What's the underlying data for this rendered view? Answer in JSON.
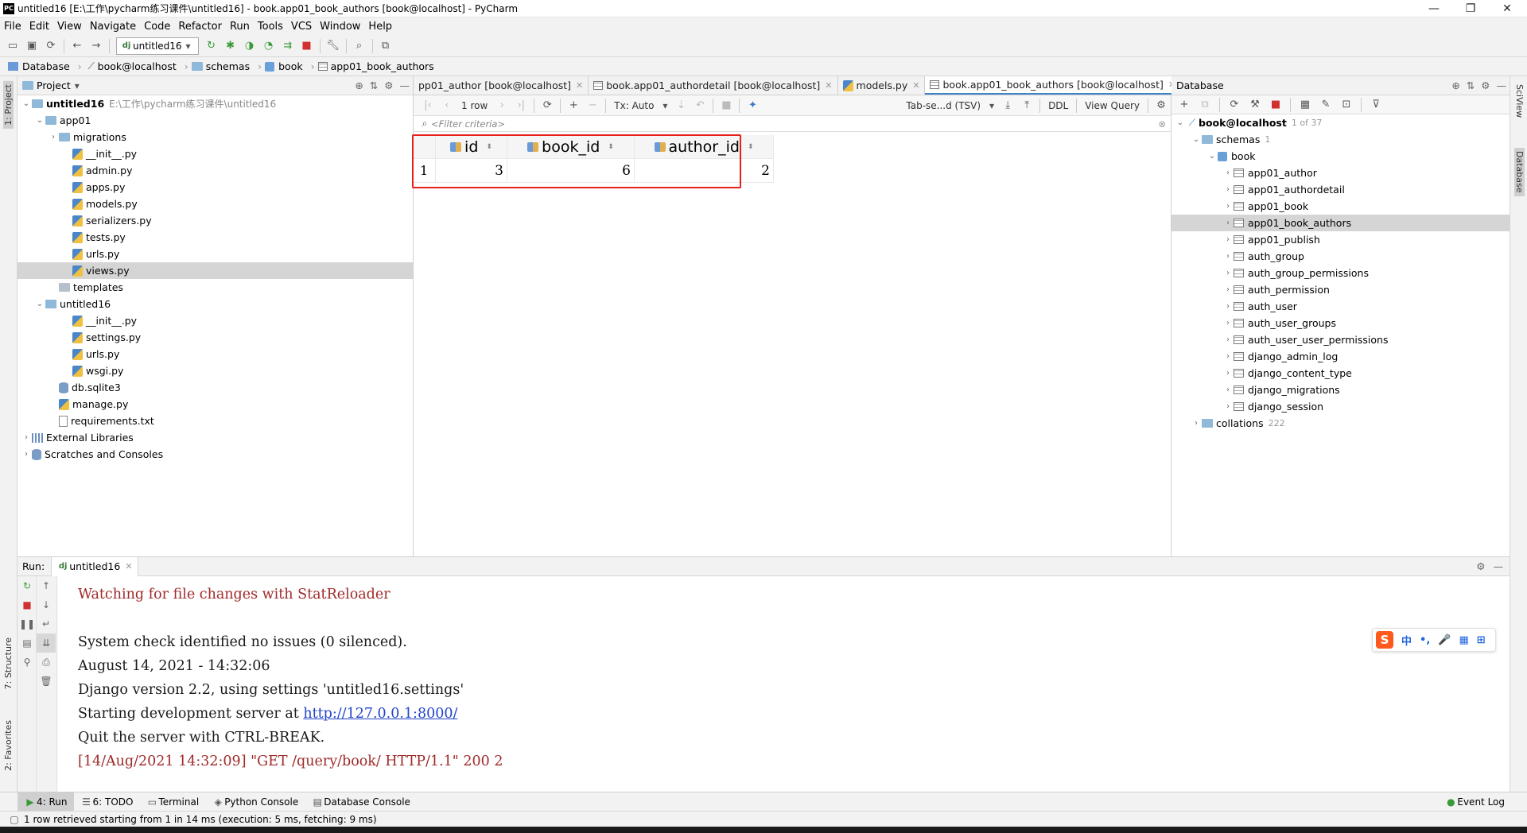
{
  "window": {
    "title": "untitled16 [E:\\工作\\pycharm练习课件\\untitled16] - book.app01_book_authors [book@localhost] - PyCharm",
    "logo": "PC",
    "controls": [
      "—",
      "❐",
      "✕"
    ]
  },
  "menu": [
    "File",
    "Edit",
    "View",
    "Navigate",
    "Code",
    "Refactor",
    "Run",
    "Tools",
    "VCS",
    "Window",
    "Help"
  ],
  "toolbar": {
    "run_config": "untitled16"
  },
  "breadcrumb": [
    "Database",
    "book@localhost",
    "schemas",
    "book",
    "app01_book_authors"
  ],
  "left_stripe": {
    "project": "1: Project",
    "structure": "7: Structure",
    "favorites": "2: Favorites"
  },
  "right_stripe": {
    "sciview": "SciView",
    "database": "Database"
  },
  "project": {
    "header": "Project",
    "rows": [
      {
        "name": "untitled16",
        "hint": "E:\\工作\\pycharm练习课件\\untitled16",
        "depth": 0,
        "kind": "folder",
        "expand": "open",
        "bold": true
      },
      {
        "name": "app01",
        "depth": 1,
        "kind": "folder",
        "expand": "open"
      },
      {
        "name": "migrations",
        "depth": 2,
        "kind": "folder",
        "expand": "closed"
      },
      {
        "name": "__init__.py",
        "depth": 3,
        "kind": "py"
      },
      {
        "name": "admin.py",
        "depth": 3,
        "kind": "py"
      },
      {
        "name": "apps.py",
        "depth": 3,
        "kind": "py"
      },
      {
        "name": "models.py",
        "depth": 3,
        "kind": "py"
      },
      {
        "name": "serializers.py",
        "depth": 3,
        "kind": "py"
      },
      {
        "name": "tests.py",
        "depth": 3,
        "kind": "py"
      },
      {
        "name": "urls.py",
        "depth": 3,
        "kind": "py"
      },
      {
        "name": "views.py",
        "depth": 3,
        "kind": "py",
        "selected": true
      },
      {
        "name": "templates",
        "depth": 2,
        "kind": "folder-gray"
      },
      {
        "name": "untitled16",
        "depth": 1,
        "kind": "folder",
        "expand": "open"
      },
      {
        "name": "__init__.py",
        "depth": 3,
        "kind": "py"
      },
      {
        "name": "settings.py",
        "depth": 3,
        "kind": "py"
      },
      {
        "name": "urls.py",
        "depth": 3,
        "kind": "py"
      },
      {
        "name": "wsgi.py",
        "depth": 3,
        "kind": "py"
      },
      {
        "name": "db.sqlite3",
        "depth": 2,
        "kind": "db"
      },
      {
        "name": "manage.py",
        "depth": 2,
        "kind": "py"
      },
      {
        "name": "requirements.txt",
        "depth": 2,
        "kind": "txt"
      },
      {
        "name": "External Libraries",
        "depth": 0,
        "kind": "lib",
        "expand": "closed"
      },
      {
        "name": "Scratches and Consoles",
        "depth": 0,
        "kind": "scratch",
        "expand": "closed"
      }
    ]
  },
  "editor_tabs": [
    {
      "label": "pp01_author [book@localhost]",
      "active": false
    },
    {
      "label": "book.app01_authordetail [book@localhost]",
      "active": false
    },
    {
      "label": "models.py",
      "active": false
    },
    {
      "label": "book.app01_book_authors [book@localhost]",
      "active": true
    }
  ],
  "editor_tabs_overflow": "4",
  "grid_toolbar": {
    "rows": "1 row",
    "tx": "Tx: Auto",
    "format": "Tab-se...d (TSV)",
    "ddl": "DDL",
    "view_query": "View Query"
  },
  "filter_placeholder": "<Filter criteria>",
  "result_grid": {
    "columns": [
      "id",
      "book_id",
      "author_id"
    ],
    "rows": [
      {
        "num": "1",
        "cells": [
          "3",
          "6",
          "2"
        ]
      }
    ]
  },
  "database_panel": {
    "header": "Database",
    "connection": "book@localhost",
    "connection_hint": "1 of 37",
    "schemas_label": "schemas",
    "schemas_count": "1",
    "schema_name": "book",
    "tables": [
      "app01_author",
      "app01_authordetail",
      "app01_book",
      "app01_book_authors",
      "app01_publish",
      "auth_group",
      "auth_group_permissions",
      "auth_permission",
      "auth_user",
      "auth_user_groups",
      "auth_user_user_permissions",
      "django_admin_log",
      "django_content_type",
      "django_migrations",
      "django_session"
    ],
    "selected_table": "app01_book_authors",
    "collations_label": "collations",
    "collations_count": "222"
  },
  "run_panel": {
    "label": "Run:",
    "tab": "untitled16",
    "lines": [
      {
        "text": "Watching for file changes with StatReloader",
        "style": "red"
      },
      {
        "text": "",
        "style": "black"
      },
      {
        "text": "System check identified no issues (0 silenced).",
        "style": "black"
      },
      {
        "text": "August 14, 2021 - 14:32:06",
        "style": "black"
      },
      {
        "text": "Django version 2.2, using settings 'untitled16.settings'",
        "style": "black"
      },
      {
        "text": "Starting development server at ",
        "style": "black",
        "link": "http://127.0.0.1:8000/"
      },
      {
        "text": "Quit the server with CTRL-BREAK.",
        "style": "black"
      },
      {
        "text": "[14/Aug/2021 14:32:09] \"GET /query/book/ HTTP/1.1\" 200 2",
        "style": "red"
      }
    ]
  },
  "ime": {
    "logo": "S",
    "items": [
      "中",
      "•,",
      "🎤",
      "▦",
      "⊞"
    ]
  },
  "bottom_tabs": [
    {
      "label": "4: Run",
      "active": true
    },
    {
      "label": "6: TODO",
      "active": false
    },
    {
      "label": "Terminal",
      "active": false
    },
    {
      "label": "Python Console",
      "active": false
    },
    {
      "label": "Database Console",
      "active": false
    }
  ],
  "event_log": "Event Log",
  "status": "1 row retrieved starting from 1 in 14 ms (execution: 5 ms, fetching: 9 ms)"
}
